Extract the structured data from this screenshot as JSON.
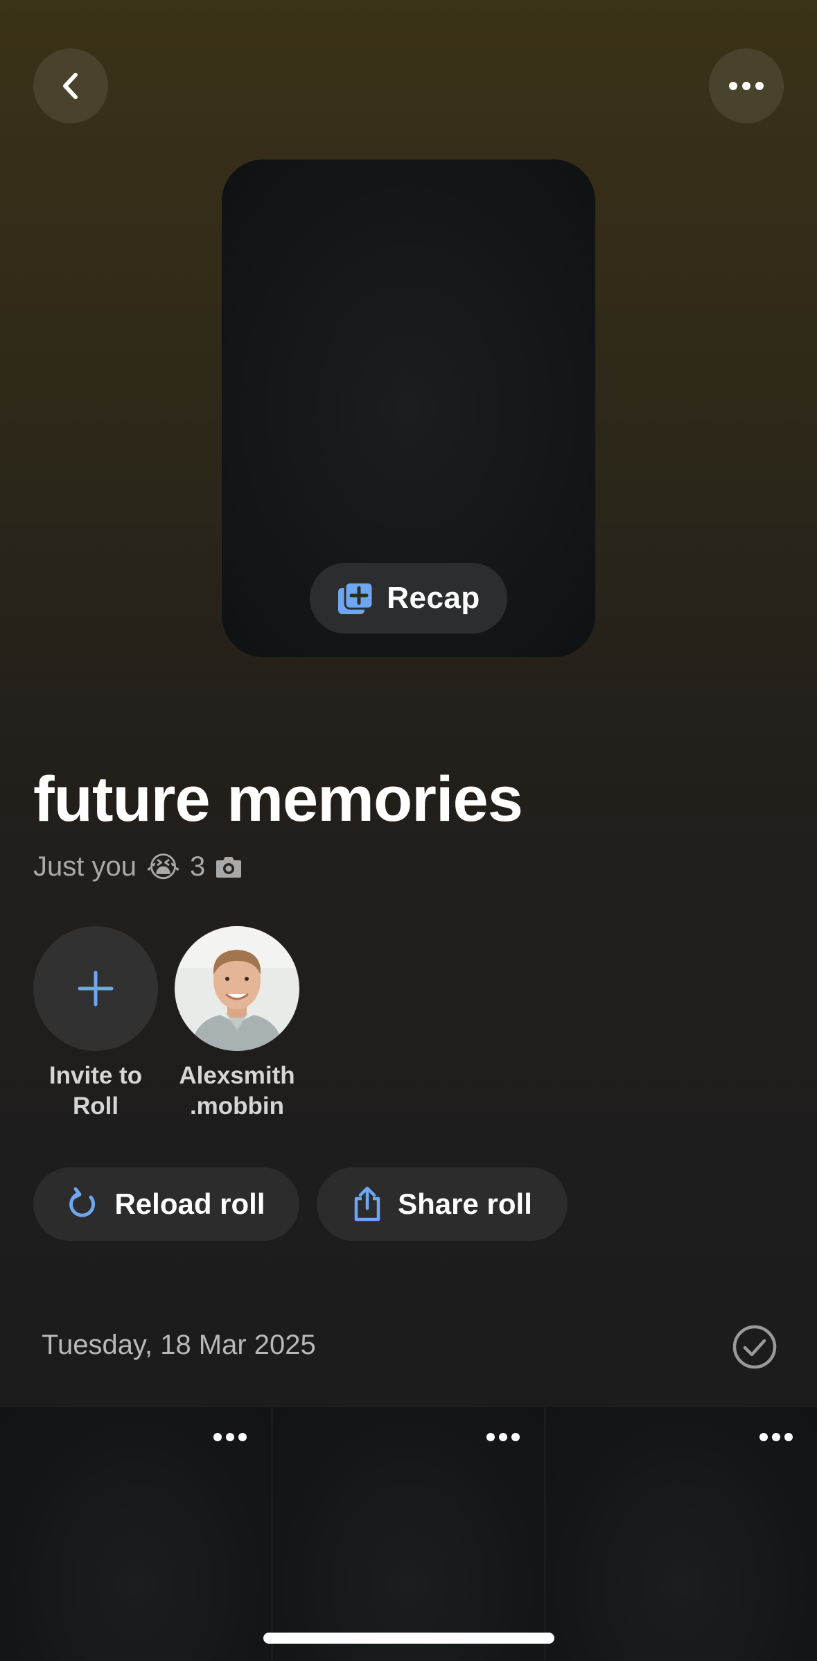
{
  "header": {
    "back_icon": "chevron-left-icon",
    "more_icon": "ellipsis-icon"
  },
  "cover": {
    "recap_label": "Recap",
    "recap_icon": "photo-add-icon"
  },
  "roll": {
    "title": "future memories",
    "members_text": "Just you",
    "emoji": "😭",
    "photo_count": "3",
    "count_icon": "camera-icon"
  },
  "members": [
    {
      "label": "Invite to\nRoll",
      "icon": "plus-icon"
    },
    {
      "label": "Alexsmith\n.mobbin",
      "icon": "avatar"
    }
  ],
  "actions": {
    "reload_label": "Reload roll",
    "share_label": "Share roll"
  },
  "section": {
    "date": "Tuesday, 18 Mar 2025"
  },
  "colors": {
    "accent": "#6ea6f2",
    "background_top": "#3b3217",
    "background_bottom": "#1b1b1b"
  }
}
